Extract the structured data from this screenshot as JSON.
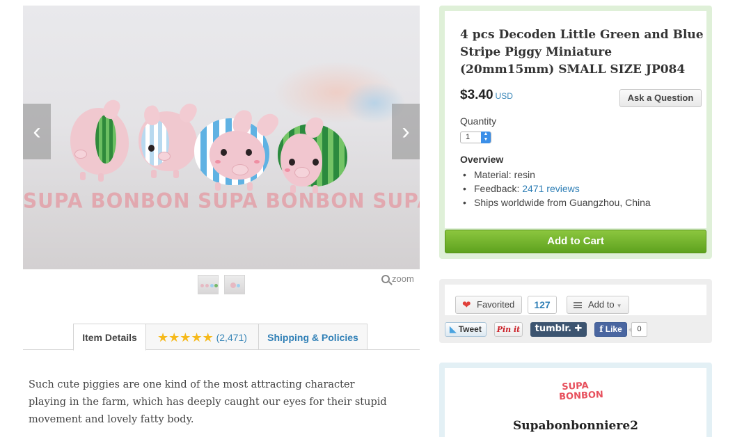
{
  "listing": {
    "title": "4 pcs Decoden Little Green and Blue Stripe Piggy Miniature (20mm15mm) SMALL SIZE JP084",
    "price": "$3.40",
    "currency": "USD",
    "ask_question": "Ask a Question",
    "quantity_label": "Quantity",
    "quantity_value": "1",
    "overview_heading": "Overview",
    "overview_material": "Material: resin",
    "overview_feedback_prefix": "Feedback: ",
    "overview_feedback_link": "2471 reviews",
    "overview_ships": "Ships worldwide from Guangzhou, China",
    "add_to_cart": "Add to Cart"
  },
  "gallery": {
    "watermark": "SUPA BONBON SUPA BONBON SUPA BONBON SUPA BONBON",
    "prev_icon": "chevron-left-icon",
    "next_icon": "chevron-right-icon",
    "zoom_label": "zoom"
  },
  "tabs": {
    "item_details": "Item Details",
    "reviews_stars": "★★★★★",
    "reviews_count": "(2,471)",
    "shipping": "Shipping & Policies"
  },
  "description": {
    "text": "Such cute piggies are one kind of the most attracting character playing in the farm, which has deeply caught our eyes for their stupid movement and lovely fatty body."
  },
  "social": {
    "favorited": "Favorited",
    "favorite_count": "127",
    "add_to": "Add to",
    "tweet": "Tweet",
    "pinit": "Pin it",
    "tumblr": "tumblr. ✚",
    "fb_like": "Like",
    "fb_count": "0"
  },
  "shop": {
    "logo_line1": "SUPA",
    "logo_line2": "BONBON",
    "name": "Supabonbonniere2"
  },
  "colors": {
    "accent_link": "#2f7fb6",
    "cart_green": "#6fb22b",
    "star_gold": "#f6b91a"
  }
}
